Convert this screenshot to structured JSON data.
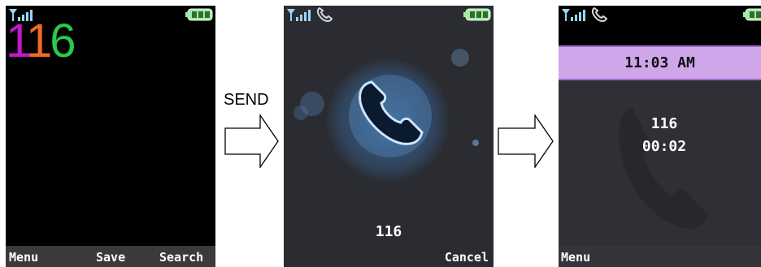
{
  "screen1": {
    "dialed_digits": [
      "1",
      "1",
      "6"
    ],
    "softkeys": {
      "left": "Menu",
      "center": "Save",
      "right": "Search"
    },
    "colors": {
      "digit1": "#c218c8",
      "digit2": "#f06a22",
      "digit3": "#2bc84a"
    }
  },
  "transition": {
    "send_label": "SEND"
  },
  "screen2": {
    "number": "116",
    "softkeys": {
      "right": "Cancel"
    }
  },
  "screen3": {
    "time": "11:03 AM",
    "number": "116",
    "duration": "00:02",
    "softkeys": {
      "left": "Menu"
    },
    "timebar_color": "#cfa6ea"
  },
  "icons": [
    "signal-icon",
    "phone-icon",
    "battery-icon",
    "call-handset-icon",
    "right-arrow-icon"
  ]
}
